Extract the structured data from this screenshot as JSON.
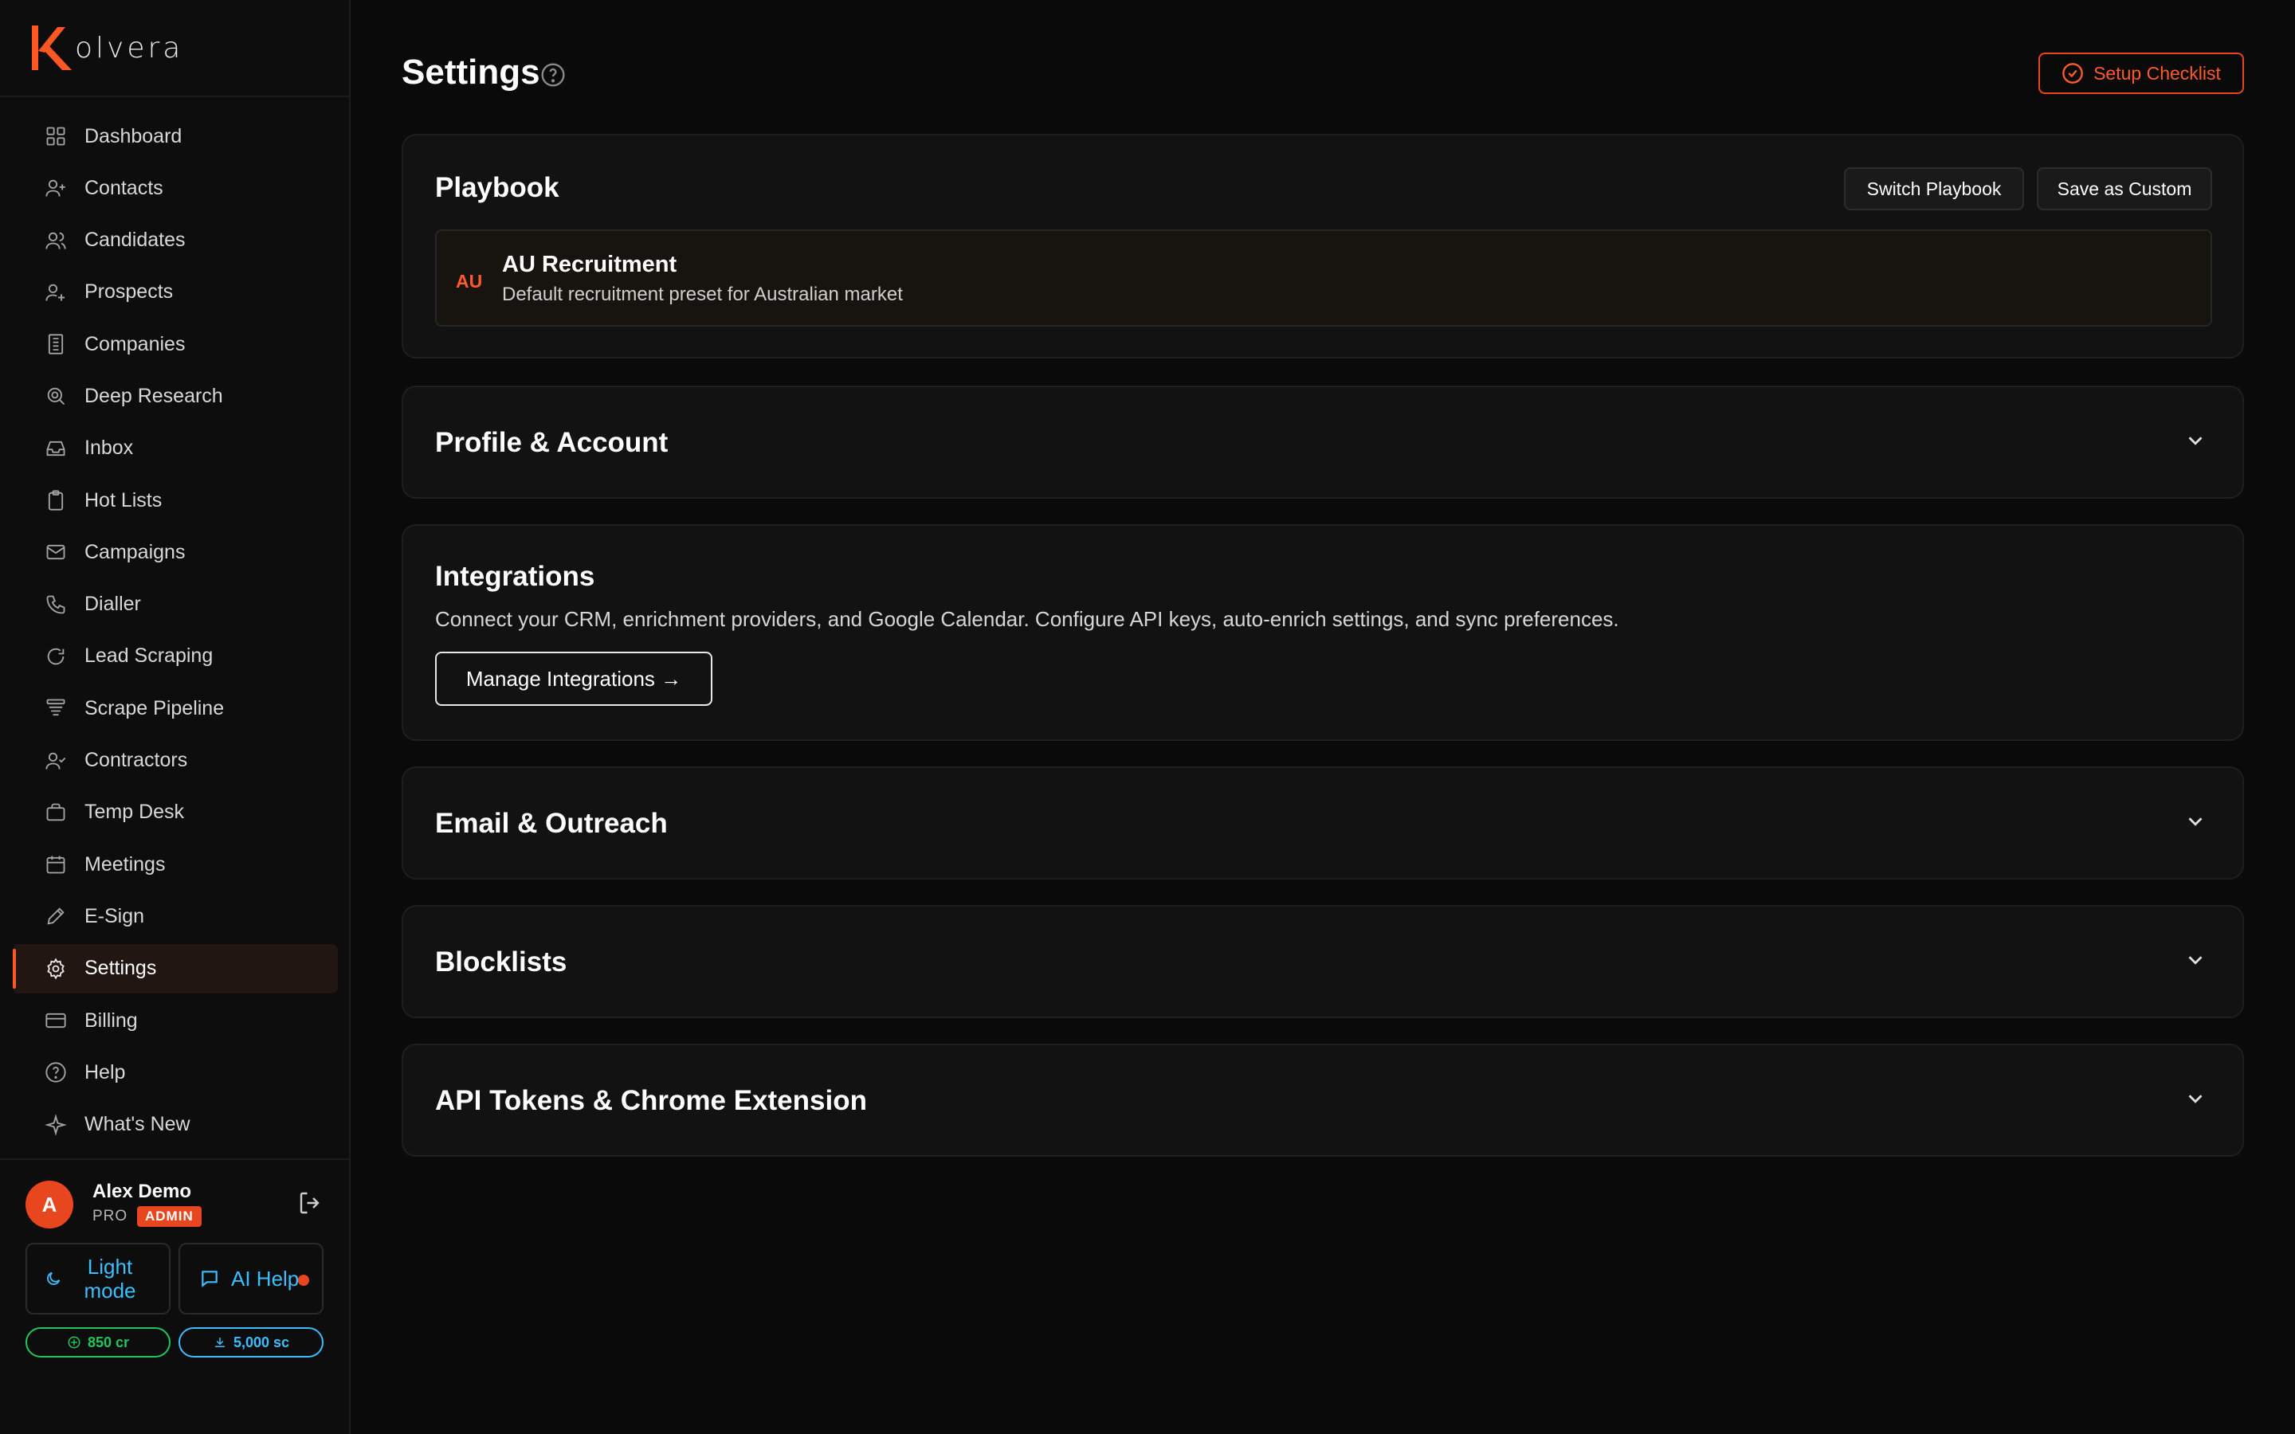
{
  "app": {
    "logo_text": "olvera"
  },
  "sidebar": {
    "items": [
      {
        "label": "Dashboard",
        "icon": "grid-icon"
      },
      {
        "label": "Contacts",
        "icon": "user-plus-icon"
      },
      {
        "label": "Candidates",
        "icon": "users-icon"
      },
      {
        "label": "Prospects",
        "icon": "user-add-icon"
      },
      {
        "label": "Companies",
        "icon": "building-icon"
      },
      {
        "label": "Deep Research",
        "icon": "search-doc-icon"
      },
      {
        "label": "Inbox",
        "icon": "inbox-icon"
      },
      {
        "label": "Hot Lists",
        "icon": "clipboard-icon"
      },
      {
        "label": "Campaigns",
        "icon": "mail-icon"
      },
      {
        "label": "Dialler",
        "icon": "phone-icon"
      },
      {
        "label": "Lead Scraping",
        "icon": "refresh-icon"
      },
      {
        "label": "Scrape Pipeline",
        "icon": "layers-icon"
      },
      {
        "label": "Contractors",
        "icon": "user-check-icon"
      },
      {
        "label": "Temp Desk",
        "icon": "briefcase-icon"
      },
      {
        "label": "Meetings",
        "icon": "calendar-icon"
      },
      {
        "label": "E-Sign",
        "icon": "pen-icon"
      },
      {
        "label": "Settings",
        "icon": "gear-icon",
        "active": true
      },
      {
        "label": "Billing",
        "icon": "credit-card-icon"
      },
      {
        "label": "Help",
        "icon": "help-circle-icon"
      },
      {
        "label": "What's New",
        "icon": "sparkle-icon"
      }
    ],
    "user": {
      "initial": "A",
      "name": "Alex Demo",
      "plan": "PRO",
      "role_badge": "ADMIN"
    },
    "mode_button": "Light mode",
    "ai_help_button": "AI Help",
    "credits": "850 cr",
    "scrape_credits": "5,000 sc"
  },
  "header": {
    "title": "Settings",
    "setup_checklist": "Setup Checklist"
  },
  "playbook": {
    "title": "Playbook",
    "switch_label": "Switch Playbook",
    "save_label": "Save as Custom",
    "preset": {
      "code": "AU",
      "name": "AU Recruitment",
      "description": "Default recruitment preset for Australian market"
    }
  },
  "sections": {
    "profile": "Profile & Account",
    "integrations": {
      "title": "Integrations",
      "description": "Connect your CRM, enrichment providers, and Google Calendar. Configure API keys, auto-enrich settings, and sync preferences.",
      "button": "Manage Integrations →"
    },
    "email": "Email & Outreach",
    "blocklists": "Blocklists",
    "api_tokens": "API Tokens & Chrome Extension"
  },
  "colors": {
    "accent": "#e8461e",
    "info": "#3dbfff",
    "success": "#22c55e",
    "background": "#0a0a0a"
  }
}
